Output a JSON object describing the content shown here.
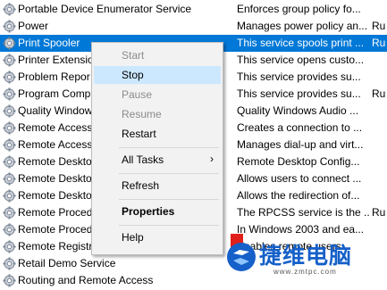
{
  "services": [
    {
      "name": "Portable Device Enumerator Service",
      "description": "Enforces group policy fo...",
      "status": ""
    },
    {
      "name": "Power",
      "description": "Manages power policy an...",
      "status": "Ru"
    },
    {
      "name": "Print Spooler",
      "description": "This service spools print ...",
      "status": "Ru",
      "selected": true
    },
    {
      "name": "Printer Extensio",
      "description": "This service opens custo...",
      "status": ""
    },
    {
      "name": "Problem Repor",
      "description": "This service provides su...",
      "status": ""
    },
    {
      "name": "Program Comp",
      "description": "This service provides su...",
      "status": "Ru"
    },
    {
      "name": "Quality Window",
      "description": "Quality Windows Audio ...",
      "status": ""
    },
    {
      "name": "Remote Access",
      "description": "Creates a connection to ...",
      "status": ""
    },
    {
      "name": "Remote Access",
      "description": "Manages dial-up and virt...",
      "status": ""
    },
    {
      "name": "Remote Deskto",
      "description": "Remote Desktop Config...",
      "status": ""
    },
    {
      "name": "Remote Deskto",
      "description": "Allows users to connect ...",
      "status": ""
    },
    {
      "name": "Remote Deskto",
      "description": "Allows the redirection of...",
      "status": ""
    },
    {
      "name": "Remote Proced",
      "description": "The RPCSS service is the ...",
      "status": "Ru"
    },
    {
      "name": "Remote Proced",
      "description": "In Windows 2003 and ea...",
      "status": ""
    },
    {
      "name": "Remote Registry",
      "description": "Enables remote users...",
      "status": ""
    },
    {
      "name": "Retail Demo Service",
      "description": "",
      "status": ""
    },
    {
      "name": "Routing and Remote Access",
      "description": "",
      "status": ""
    }
  ],
  "context_menu": {
    "start": "Start",
    "stop": "Stop",
    "pause": "Pause",
    "resume": "Resume",
    "restart": "Restart",
    "all_tasks": "All Tasks",
    "all_tasks_arrow": "›",
    "refresh": "Refresh",
    "properties": "Properties",
    "help": "Help"
  },
  "watermark": {
    "text": "捷维电脑",
    "url": "www.zmtpc.com"
  },
  "colors": {
    "selection": "#0078d7",
    "menu_hover": "#cce8ff",
    "watermark_blue": "#1560c9"
  }
}
